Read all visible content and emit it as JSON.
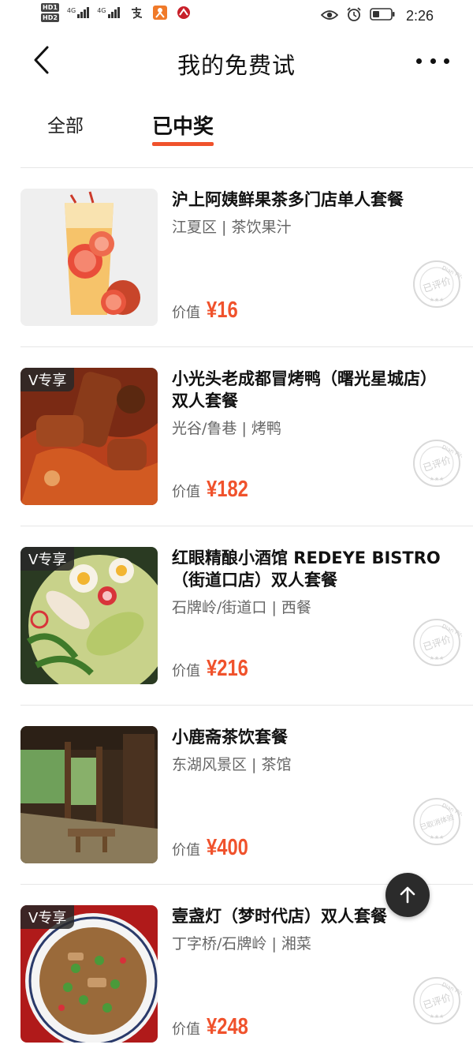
{
  "status_bar": {
    "sim1": "HD",
    "sim1_index": "1",
    "sim2": "HD",
    "sim2_index": "2",
    "network1": "4G",
    "network2": "4G",
    "time": "2:26",
    "icons": [
      "alipay-icon",
      "app-icon",
      "app2-icon",
      "eye-icon",
      "alarm-icon",
      "battery-icon"
    ]
  },
  "header": {
    "title": "我的免费试"
  },
  "tabs": [
    {
      "label": "全部",
      "active": false
    },
    {
      "label": "已中奖",
      "active": true
    }
  ],
  "deals": [
    {
      "title": "沪上阿姨鲜果茶多门店单人套餐",
      "subtitle": "江夏区 | 茶饮果汁",
      "price_label": "价值",
      "price": "¥16",
      "badge": "",
      "stamp": "已评价",
      "stamp_ring": "Dian Ping",
      "image": "fruit-tea-image"
    },
    {
      "title": "小光头老成都冒烤鸭（曙光星城店）双人套餐",
      "subtitle": "光谷/鲁巷 | 烤鸭",
      "price_label": "价值",
      "price": "¥182",
      "badge": "V专享",
      "stamp": "已评价",
      "stamp_ring": "Dian Ping",
      "image": "roast-duck-image"
    },
    {
      "title": "红眼精酿小酒馆 REDEYE BISTRO（街道口店）双人套餐",
      "subtitle": "石牌岭/街道口 | 西餐",
      "price_label": "价值",
      "price": "¥216",
      "badge": "V专享",
      "stamp": "已评价",
      "stamp_ring": "Dian Ping",
      "image": "salad-image"
    },
    {
      "title": "小鹿斋茶饮套餐",
      "subtitle": "东湖风景区 | 茶馆",
      "price_label": "价值",
      "price": "¥400",
      "badge": "",
      "stamp": "已取消体验",
      "stamp_ring": "Dian Ping",
      "image": "teahouse-image"
    },
    {
      "title": "壹盏灯（梦时代店）双人套餐",
      "subtitle": "丁字桥/石牌岭 | 湘菜",
      "price_label": "价值",
      "price": "¥248",
      "badge": "V专享",
      "stamp": "已评价",
      "stamp_ring": "Dian Ping",
      "image": "hunan-dish-image"
    }
  ],
  "colors": {
    "accent": "#f0522c",
    "fab": "#2b2b2b",
    "divider": "#e6e6e6"
  }
}
